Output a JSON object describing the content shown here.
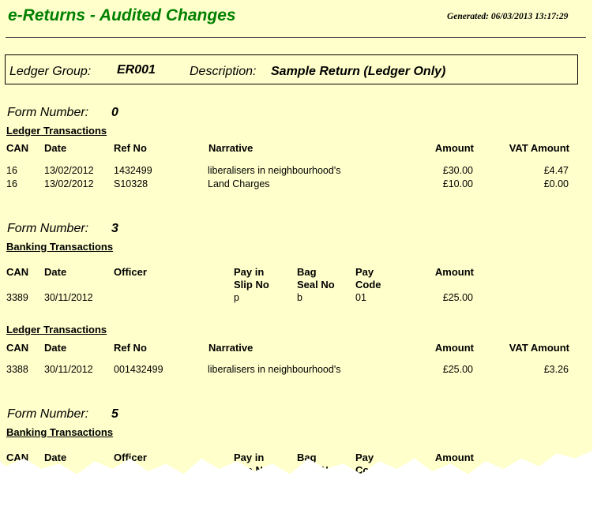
{
  "report": {
    "title": "e-Returns - Audited Changes",
    "generated": "Generated: 06/03/2013 13:17:29",
    "ledger_group_label": "Ledger Group:",
    "ledger_group": "ER001",
    "description_label": "Description:",
    "description": "Sample Return (Ledger Only)"
  },
  "labels": {
    "form_number": "Form Number:",
    "ledger_transactions": "Ledger Transactions",
    "banking_transactions": "Banking Transactions"
  },
  "ledger_columns": {
    "can": "CAN",
    "date": "Date",
    "ref_no": "Ref No",
    "narrative": "Narrative",
    "amount": "Amount",
    "vat_amount": "VAT Amount"
  },
  "banking_columns": {
    "can": "CAN",
    "date": "Date",
    "officer": "Officer",
    "pay_in_slip": "Pay in\nSlip No",
    "bag_seal": "Bag\nSeal No",
    "pay_code": "Pay\nCode",
    "amount": "Amount"
  },
  "forms": [
    {
      "number": "0",
      "ledger_rows": [
        {
          "can": "16",
          "date": "13/02/2012",
          "ref_no": "1432499",
          "narrative": "liberalisers in neighbourhood's",
          "amount": "£30.00",
          "vat": "£4.47"
        },
        {
          "can": "16",
          "date": "13/02/2012",
          "ref_no": "S10328",
          "narrative": "Land Charges",
          "amount": "£10.00",
          "vat": "£0.00"
        }
      ]
    },
    {
      "number": "3",
      "banking_rows": [
        {
          "can": "3389",
          "date": "30/11/2012",
          "officer": "",
          "slip": "p",
          "bag": "b",
          "code": "01",
          "amount": "£25.00"
        }
      ],
      "ledger_rows": [
        {
          "can": "3388",
          "date": "30/11/2012",
          "ref_no": "001432499",
          "narrative": "liberalisers in neighbourhood's",
          "amount": "£25.00",
          "vat": "£3.26"
        }
      ]
    },
    {
      "number": "5"
    }
  ]
}
